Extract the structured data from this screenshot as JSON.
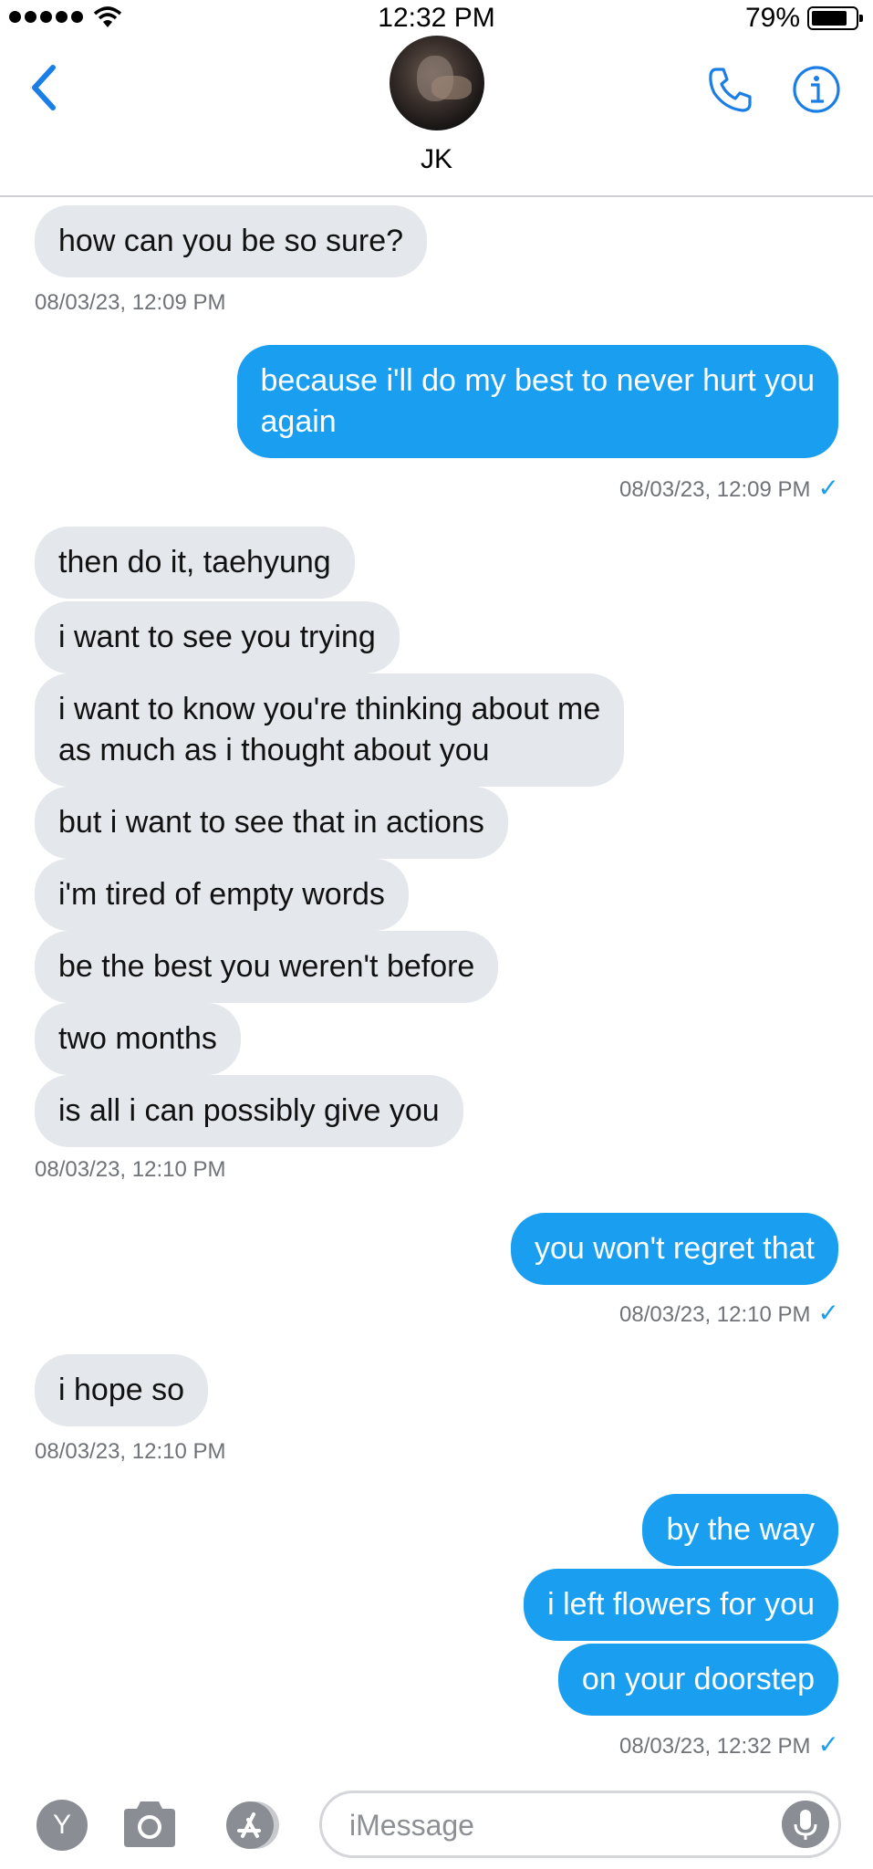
{
  "status_bar": {
    "time": "12:32 PM",
    "battery": "79%"
  },
  "header": {
    "contact_name": "JK"
  },
  "messages": [
    {
      "dir": "in",
      "text": "how can you be so sure?"
    },
    {
      "dir": "out",
      "text": "because i'll do my best to never hurt you\nagain"
    },
    {
      "dir": "in",
      "text": "then do it, taehyung"
    },
    {
      "dir": "in",
      "text": "i want to see you trying"
    },
    {
      "dir": "in",
      "text": "i want to know you're thinking about me\nas much as i thought about you"
    },
    {
      "dir": "in",
      "text": "but i want to see that in actions"
    },
    {
      "dir": "in",
      "text": "i'm tired of empty words"
    },
    {
      "dir": "in",
      "text": "be the best you weren't before"
    },
    {
      "dir": "in",
      "text": "two months"
    },
    {
      "dir": "in",
      "text": "is all i can possibly give you"
    },
    {
      "dir": "out",
      "text": "you won't regret that"
    },
    {
      "dir": "in",
      "text": "i hope so"
    },
    {
      "dir": "out",
      "text": "by the way"
    },
    {
      "dir": "out",
      "text": "i left flowers for you"
    },
    {
      "dir": "out",
      "text": "on your doorstep"
    }
  ],
  "timestamps": [
    {
      "text": "08/03/23, 12:09 PM",
      "read": false
    },
    {
      "text": "08/03/23, 12:09 PM",
      "read": true
    },
    {
      "text": "08/03/23, 12:10 PM",
      "read": false
    },
    {
      "text": "08/03/23, 12:10 PM",
      "read": true
    },
    {
      "text": "08/03/23, 12:10 PM",
      "read": false
    },
    {
      "text": "08/03/23, 12:32 PM",
      "read": true
    }
  ],
  "input": {
    "placeholder": "iMessage"
  },
  "apps": {
    "first_app_letter": "Y"
  },
  "icons": {
    "back": "chevron-left-icon",
    "call": "phone-icon",
    "info": "info-icon",
    "camera": "camera-icon",
    "appstore": "app-store-icon",
    "mic": "microphone-icon"
  },
  "colors": {
    "accent": "#1a9ff0",
    "incoming_bubble": "#e4e8ed",
    "timestamp": "#6f7378"
  }
}
